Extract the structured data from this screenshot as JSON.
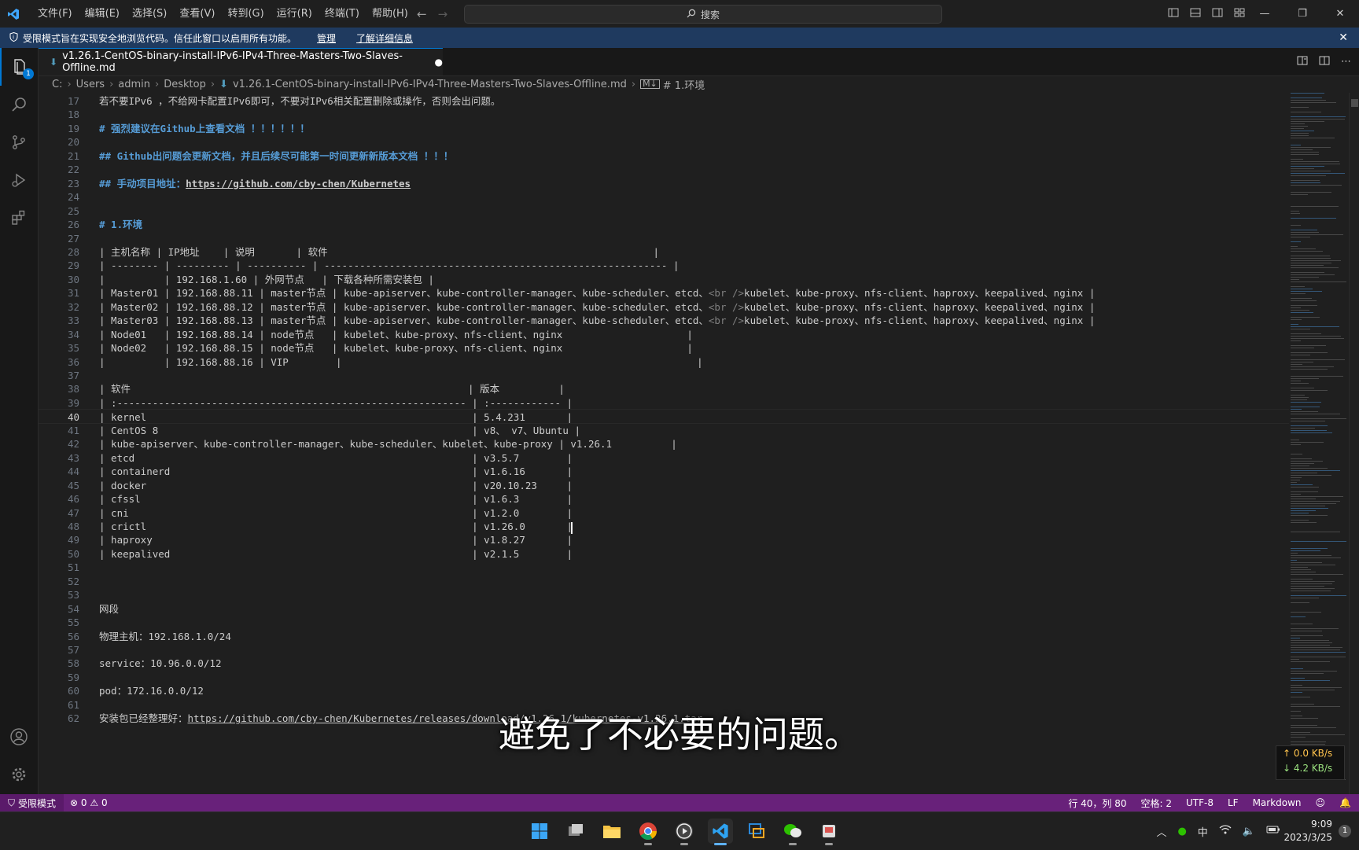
{
  "titlebar": {
    "menu": [
      "文件(F)",
      "编辑(E)",
      "选择(S)",
      "查看(V)",
      "转到(G)",
      "运行(R)",
      "终端(T)",
      "帮助(H)"
    ],
    "search_placeholder": "搜索"
  },
  "banner": {
    "message": "受限模式旨在实现安全地浏览代码。信任此窗口以启用所有功能。",
    "manage": "管理",
    "learn_more": "了解详细信息"
  },
  "activity": {
    "explorer_badge": "1"
  },
  "tab": {
    "title": "v1.26.1-CentOS-binary-install-IPv6-IPv4-Three-Masters-Two-Slaves-Offline.md"
  },
  "breadcrumb": {
    "parts": [
      "C:",
      "Users",
      "admin",
      "Desktop",
      "v1.26.1-CentOS-binary-install-IPv6-IPv4-Three-Masters-Two-Slaves-Offline.md",
      "# 1.环境"
    ]
  },
  "editor": {
    "current_line": 40,
    "lines": [
      {
        "n": "17",
        "t": "若不要IPv6 ，不给网卡配置IPv6即可，不要对IPv6相关配置删除或操作，否则会出问题。"
      },
      {
        "n": "18",
        "t": ""
      },
      {
        "n": "19",
        "t": "# 强烈建议在Github上查看文档 ！！！！！！"
      },
      {
        "n": "20",
        "t": ""
      },
      {
        "n": "21",
        "t": "## Github出问题会更新文档，并且后续尽可能第一时间更新新版本文档 ！！！"
      },
      {
        "n": "22",
        "t": ""
      },
      {
        "n": "23",
        "t": "## 手动项目地址：https://github.com/cby-chen/Kubernetes"
      },
      {
        "n": "24",
        "t": ""
      },
      {
        "n": "25",
        "t": ""
      },
      {
        "n": "26",
        "t": "# 1.环境"
      },
      {
        "n": "27",
        "t": ""
      },
      {
        "n": "28",
        "t": "| 主机名称 | IP地址    | 说明       | 软件                                                       |"
      },
      {
        "n": "29",
        "t": "| -------- | --------- | ---------- | ---------------------------------------------------------- |"
      },
      {
        "n": "30",
        "t": "|          | 192.168.1.60 | 外网节点   | 下载各种所需安装包 |"
      },
      {
        "n": "31",
        "t": "| Master01 | 192.168.88.11 | master节点 | kube-apiserver、kube-controller-manager、kube-scheduler、etcd、<br />kubelet、kube-proxy、nfs-client、haproxy、keepalived、nginx |"
      },
      {
        "n": "32",
        "t": "| Master02 | 192.168.88.12 | master节点 | kube-apiserver、kube-controller-manager、kube-scheduler、etcd、<br />kubelet、kube-proxy、nfs-client、haproxy、keepalived、nginx |"
      },
      {
        "n": "33",
        "t": "| Master03 | 192.168.88.13 | master节点 | kube-apiserver、kube-controller-manager、kube-scheduler、etcd、<br />kubelet、kube-proxy、nfs-client、haproxy、keepalived、nginx |"
      },
      {
        "n": "34",
        "t": "| Node01   | 192.168.88.14 | node节点   | kubelet、kube-proxy、nfs-client、nginx                     |"
      },
      {
        "n": "35",
        "t": "| Node02   | 192.168.88.15 | node节点   | kubelet、kube-proxy、nfs-client、nginx                     |"
      },
      {
        "n": "36",
        "t": "|          | 192.168.88.16 | VIP        |                                                            |"
      },
      {
        "n": "37",
        "t": ""
      },
      {
        "n": "38",
        "t": "| 软件                                                         | 版本          |"
      },
      {
        "n": "39",
        "t": "| :----------------------------------------------------------- | :------------ |"
      },
      {
        "n": "40",
        "t": "| kernel                                                       | 5.4.231       |"
      },
      {
        "n": "41",
        "t": "| CentOS 8                                                     | v8、 v7、Ubuntu |"
      },
      {
        "n": "42",
        "t": "| kube-apiserver、kube-controller-manager、kube-scheduler、kubelet、kube-proxy | v1.26.1          |"
      },
      {
        "n": "43",
        "t": "| etcd                                                         | v3.5.7        |"
      },
      {
        "n": "44",
        "t": "| containerd                                                   | v1.6.16       |"
      },
      {
        "n": "45",
        "t": "| docker                                                       | v20.10.23     |"
      },
      {
        "n": "46",
        "t": "| cfssl                                                        | v1.6.3        |"
      },
      {
        "n": "47",
        "t": "| cni                                                          | v1.2.0        |"
      },
      {
        "n": "48",
        "t": "| crictl                                                       | v1.26.0       |"
      },
      {
        "n": "49",
        "t": "| haproxy                                                      | v1.8.27       |"
      },
      {
        "n": "50",
        "t": "| keepalived                                                   | v2.1.5        |"
      },
      {
        "n": "51",
        "t": ""
      },
      {
        "n": "52",
        "t": ""
      },
      {
        "n": "53",
        "t": ""
      },
      {
        "n": "54",
        "t": "网段"
      },
      {
        "n": "55",
        "t": ""
      },
      {
        "n": "56",
        "t": "物理主机：192.168.1.0/24"
      },
      {
        "n": "57",
        "t": ""
      },
      {
        "n": "58",
        "t": "service：10.96.0.0/12"
      },
      {
        "n": "59",
        "t": ""
      },
      {
        "n": "60",
        "t": "pod：172.16.0.0/12"
      },
      {
        "n": "61",
        "t": ""
      },
      {
        "n": "62",
        "t": "安装包已经整理好：https://github.com/cby-chen/Kubernetes/releases/download/v1.26.1/kubernetes-v1.26.1.tar"
      }
    ]
  },
  "netspeed": {
    "up": "↑ 0.0 KB/s",
    "down": "↓ 4.2 KB/s"
  },
  "subtitle": "避免了不必要的问题。",
  "statusbar": {
    "restricted": "受限模式",
    "errors": "0",
    "warnings": "0",
    "position": "行 40，列 80",
    "spaces": "空格: 2",
    "encoding": "UTF-8",
    "eol": "LF",
    "language": "Markdown"
  },
  "taskbar": {
    "ime": "中",
    "time": "9:09",
    "date": "2023/3/25",
    "notification_count": "1"
  },
  "colors": {
    "statusbar": "#68217a",
    "banner": "#1f3a5f",
    "accent": "#0078d4",
    "heading": "#569cd6"
  }
}
